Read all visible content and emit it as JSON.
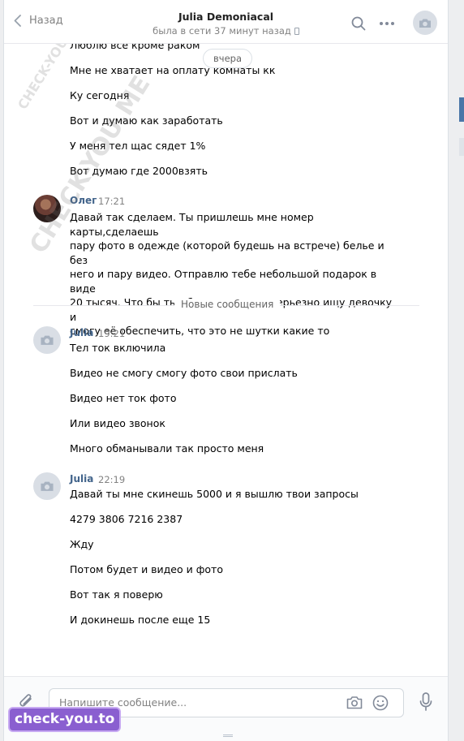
{
  "header": {
    "back_label": "Назад",
    "title": "Julia Demoniacal",
    "status": "была в сети 37 минут назад"
  },
  "date_divider": "вчера",
  "earlier_lines": [
    "Люблю все кроме раком",
    "Мне не хватает на оплату комнаты кк",
    "Ку сегодня",
    "Вот и думаю как заработать",
    "У меня тел щас сядет 1%",
    "Вот думаю где 2000взять"
  ],
  "msg_oleg": {
    "author": "Олег",
    "time": "17:21",
    "lines": [
      "Давай так сделаем. Ты пришлешь мне номер карты,сделаешь",
      "пару фото в одежде (которой будешь на встрече) белье и без",
      "него и пару видео. Отправлю тебе небольшой подарок в виде",
      "20 тысяч. Что бы ты убедилась что я серьезно ищу девочку и",
      "смогу её обеспечить, что это не шутки какие то"
    ]
  },
  "new_messages_label": "Новые сообщения",
  "msg_julia_1": {
    "author": "Julia",
    "time": "19:21",
    "lines": [
      "Тел ток включила",
      "Видео не смогу смогу фото свои прислать",
      "Видео нет ток фото",
      "Или видео звонок",
      "Много обманывали так просто меня"
    ]
  },
  "msg_julia_2": {
    "author": "Julia",
    "time": "22:19",
    "lines": [
      "Давай ты мне скинешь 5000 и я вышлю твои запросы",
      "4279 3806 7216 2387",
      "Жду",
      "Потом будет и видео и фото",
      "Вот так я поверю",
      "И докинешь после еще 15"
    ]
  },
  "composer": {
    "placeholder": "Напишите сообщение..."
  },
  "watermarks": {
    "diagonal": "CHECK-YOU.ME",
    "logo": "check-you.to"
  },
  "colors": {
    "author": "#42648b",
    "accent": "#4a76a8",
    "logo_bg": "#8a5fd0"
  }
}
